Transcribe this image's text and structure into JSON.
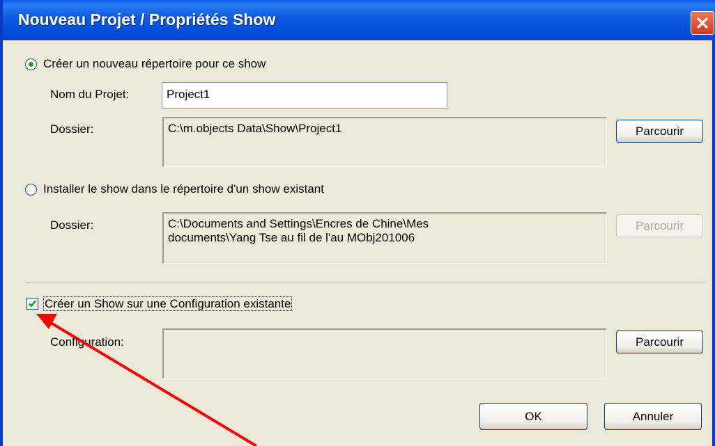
{
  "window": {
    "title": "Nouveau Projet / Propriétés Show",
    "close_icon": "close-icon"
  },
  "new_dir": {
    "radio_label": "Créer un nouveau répertoire pour ce show",
    "selected": true,
    "project_name_label": "Nom du Projet:",
    "project_name_value": "Project1",
    "folder_label": "Dossier:",
    "folder_value": "C:\\m.objects Data\\Show\\Project1",
    "browse_label": "Parcourir"
  },
  "existing_dir": {
    "radio_label": "Installer le show dans le répertoire d'un show existant",
    "selected": false,
    "folder_label": "Dossier:",
    "folder_value": "C:\\Documents and Settings\\Encres de Chine\\Mes\ndocuments\\Yang Tse au fil de l'au MObj201006",
    "browse_label": "Parcourir"
  },
  "config": {
    "checkbox_label": "Créer un Show sur une Configuration existante",
    "checked": true,
    "config_label": "Configuration:",
    "config_value": "",
    "browse_label": "Parcourir"
  },
  "footer": {
    "ok_label": "OK",
    "cancel_label": "Annuler"
  },
  "colors": {
    "titlebar": "#0045d2",
    "dialog_bg": "#ece9d8",
    "annotation_arrow": "#ff0000",
    "check": "#21a121"
  }
}
